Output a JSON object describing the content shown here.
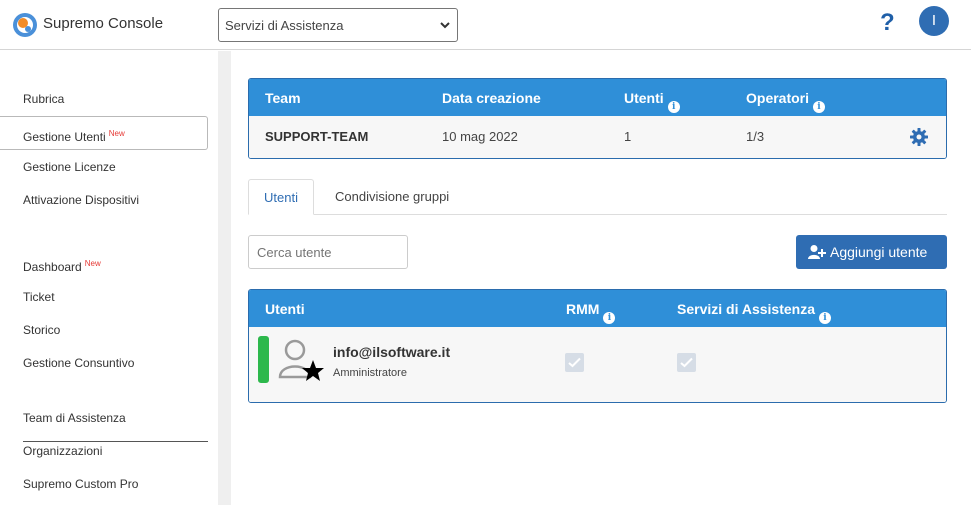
{
  "header": {
    "app_title": "Supremo Console",
    "selected_service": "Servizi di Assistenza",
    "help_label": "?",
    "avatar_initial": "I"
  },
  "sidebar": {
    "items": [
      {
        "label": "Rubrica",
        "badge": ""
      },
      {
        "label": "Gestione Utenti",
        "badge": "New",
        "active": true
      },
      {
        "label": "Gestione Licenze",
        "badge": ""
      },
      {
        "label": "Attivazione Dispositivi",
        "badge": ""
      },
      {
        "label": "Dashboard",
        "badge": "New"
      },
      {
        "label": "Ticket",
        "badge": ""
      },
      {
        "label": "Storico",
        "badge": ""
      },
      {
        "label": "Gestione Consuntivo",
        "badge": ""
      },
      {
        "label": "Team di Assistenza",
        "badge": ""
      },
      {
        "label": "Organizzazioni",
        "badge": ""
      },
      {
        "label": "Supremo Custom Pro",
        "badge": ""
      }
    ]
  },
  "team_table": {
    "headers": [
      "Team",
      "Data creazione",
      "Utenti",
      "Operatori"
    ],
    "row": {
      "team": "SUPPORT-TEAM",
      "created": "10 mag 2022",
      "users": "1",
      "operators": "1/3"
    }
  },
  "tabs": [
    {
      "label": "Utenti",
      "active": true
    },
    {
      "label": "Condivisione gruppi",
      "active": false
    }
  ],
  "search": {
    "placeholder": "Cerca utente"
  },
  "add_button": {
    "label": "Aggiungi utente"
  },
  "users_table": {
    "headers": [
      "Utenti",
      "RMM",
      "Servizi di Assistenza"
    ],
    "rows": [
      {
        "email": "info@ilsoftware.it",
        "role": "Amministratore",
        "rmm": true,
        "assistance": true,
        "status_color": "#2db84c"
      }
    ]
  },
  "colors": {
    "accent": "#2f8fd8",
    "primary": "#2f6db3",
    "status_online": "#2db84c",
    "badge_new": "#e53935"
  }
}
